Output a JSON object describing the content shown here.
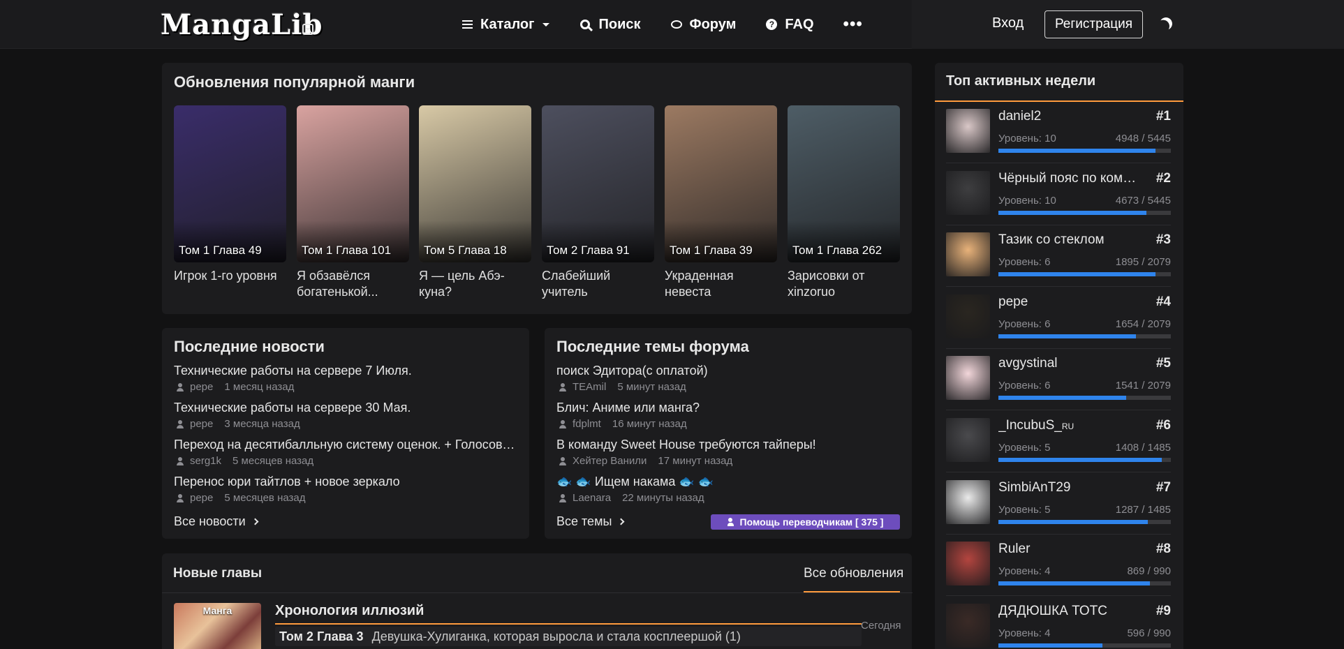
{
  "header": {
    "logo": "MangaLib",
    "nav": [
      {
        "label": "Каталог",
        "icon": "burger-icon"
      },
      {
        "label": "Поиск",
        "icon": "search-icon"
      },
      {
        "label": "Форум",
        "icon": "chat-icon"
      },
      {
        "label": "FAQ",
        "icon": "question-icon"
      }
    ],
    "login": "Вход",
    "register": "Регистрация"
  },
  "popular": {
    "title": "Обновления популярной манги",
    "items": [
      {
        "chapter": "Том 1 Глава 49",
        "title": "Игрок 1-го уровня",
        "color": "#3a2d6a"
      },
      {
        "chapter": "Том 1 Глава 101",
        "title": "Я обзавёлся богатенькой...",
        "color": "#d9a3a0"
      },
      {
        "chapter": "Том 5 Глава 18",
        "title": "Я — цель Абэ-куна?",
        "color": "#d8c9a6"
      },
      {
        "chapter": "Том 2 Глава 91",
        "title": "Слабейший учитель",
        "color": "#4d4f5e"
      },
      {
        "chapter": "Том 1 Глава 39",
        "title": "Украденная невеста",
        "color": "#9c7a62"
      },
      {
        "chapter": "Том 1 Глава 262",
        "title": "Зарисовки от xinzoruo",
        "color": "#4e5d66"
      }
    ]
  },
  "news": {
    "title": "Последние новости",
    "items": [
      {
        "title": "Технические работы на сервере 7 Июля.",
        "author": "pepe",
        "time": "1 месяц назад"
      },
      {
        "title": "Технические работы на сервере 30 Мая.",
        "author": "pepe",
        "time": "3 месяца назад"
      },
      {
        "title": "Переход на десятибалльную систему оценок. + Голосование",
        "author": "serg1k",
        "time": "5 месяцев назад"
      },
      {
        "title": "Перенос юри тайтлов + новое зеркало",
        "author": "pepe",
        "time": "5 месяцев назад"
      }
    ],
    "all": "Все новости"
  },
  "forum": {
    "title": "Последние темы форума",
    "items": [
      {
        "title": "поиск Эдитора(с оплатой)",
        "author": "TEAmil",
        "time": "5 минут назад"
      },
      {
        "title": "Блич: Аниме или манга?",
        "author": "fdplmt",
        "time": "16 минут назад"
      },
      {
        "title": "В команду Sweet House требуются тайперы!",
        "author": "Хейтер Ванили",
        "time": "17 минут назад"
      },
      {
        "title": "🐟 🐟 Ищем накама 🐟 🐟",
        "author": "Laenara",
        "time": "22 минуты назад"
      }
    ],
    "all": "Все темы",
    "help": "Помощь переводчикам [ 375 ]"
  },
  "new_chapters": {
    "title": "Новые главы",
    "tab": "Все обновления",
    "item": {
      "badge": "Манга",
      "title": "Хронология иллюзий",
      "chapter": "Том 2 Глава 3",
      "chapter_name": "Девушка-Хулиганка, которая выросла и стала косплеершой (1)",
      "date": "Сегодня"
    }
  },
  "top": {
    "title": "Топ активных недели",
    "users": [
      {
        "name": "daniel2",
        "rank": "#1",
        "level": "Уровень: 10",
        "xp": "4948 / 5445",
        "progress": 0.909,
        "color": "#d9c7c7"
      },
      {
        "name": "Чёрный пояс по коммуникации",
        "rank": "#2",
        "level": "Уровень: 10",
        "xp": "4673 / 5445",
        "progress": 0.858,
        "color": "#3e3e40"
      },
      {
        "name": "Тазик со стеклом",
        "rank": "#3",
        "level": "Уровень: 6",
        "xp": "1895 / 2079",
        "progress": 0.911,
        "color": "#e8b27a"
      },
      {
        "name": "pepe",
        "rank": "#4",
        "level": "Уровень: 6",
        "xp": "1654 / 2079",
        "progress": 0.796,
        "color": "#2a2620"
      },
      {
        "name": "avgystinal",
        "rank": "#5",
        "level": "Уровень: 6",
        "xp": "1541 / 2079",
        "progress": 0.741,
        "color": "#f2d6da"
      },
      {
        "name": "_IncubuS_",
        "name_suffix": "RU",
        "rank": "#6",
        "level": "Уровень: 5",
        "xp": "1408 / 1485",
        "progress": 0.948,
        "color": "#4a4a4d"
      },
      {
        "name": "SimbiAnT29",
        "rank": "#7",
        "level": "Уровень: 5",
        "xp": "1287 / 1485",
        "progress": 0.867,
        "color": "#eaeaea"
      },
      {
        "name": "Ruler",
        "rank": "#8",
        "level": "Уровень: 4",
        "xp": "869 / 990",
        "progress": 0.878,
        "color": "#b3453f"
      },
      {
        "name": "ДЯДЮШКА ТОТС",
        "rank": "#9",
        "level": "Уровень: 4",
        "xp": "596 / 990",
        "progress": 0.602,
        "color": "#3a2a26"
      }
    ]
  }
}
